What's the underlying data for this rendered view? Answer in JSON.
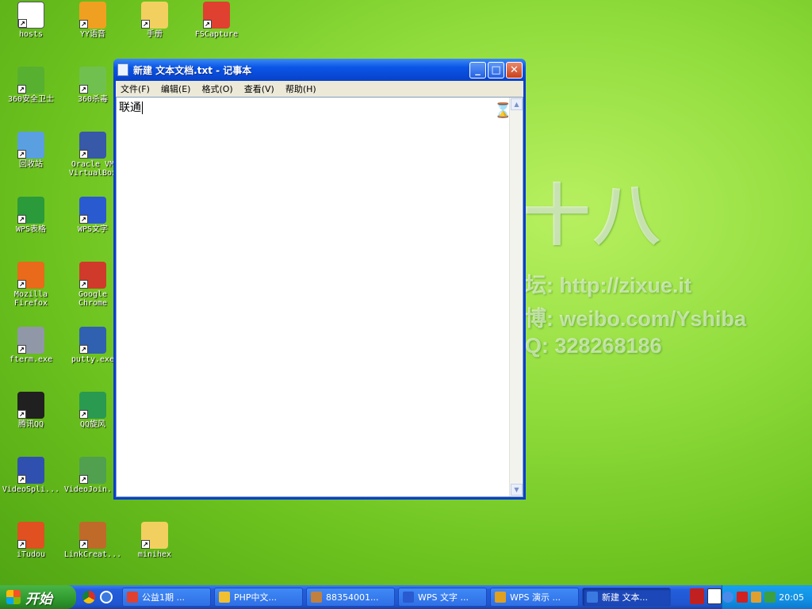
{
  "wallpaper": {
    "logo": "十八",
    "line1": "坛: http://zixue.it",
    "line2": "博: weibo.com/Yshiba",
    "line3": "Q: 328268186"
  },
  "desktop_icons": [
    {
      "label": "hosts",
      "icon": "text-file-icon",
      "color": "#ffffff"
    },
    {
      "label": "YY语音",
      "icon": "yy-voice-icon",
      "color": "#f0a020"
    },
    {
      "label": "手册",
      "icon": "folder-icon",
      "color": "#f2d060"
    },
    {
      "label": "FSCapture",
      "icon": "fscapture-icon",
      "color": "#e04030"
    },
    {
      "label": "360安全卫士",
      "icon": "360-security-icon",
      "color": "#58b030"
    },
    {
      "label": "360杀毒",
      "icon": "360-antivirus-icon",
      "color": "#70c050"
    },
    {
      "label": "回收站",
      "icon": "recycle-bin-icon",
      "color": "#5aa0e0"
    },
    {
      "label": "Oracle VM\nVirtualBox",
      "icon": "virtualbox-icon",
      "color": "#3858a8"
    },
    {
      "label": "WPS表格",
      "icon": "wps-spreadsheet-icon",
      "color": "#2a9a3a"
    },
    {
      "label": "WPS文字",
      "icon": "wps-writer-icon",
      "color": "#2a5ad0"
    },
    {
      "label": "Mozilla\nFirefox",
      "icon": "firefox-icon",
      "color": "#e86a1a"
    },
    {
      "label": "Google\nChrome",
      "icon": "chrome-icon",
      "color": "#d03a2a"
    },
    {
      "label": "fterm.exe",
      "icon": "fterm-icon",
      "color": "#9098a8"
    },
    {
      "label": "putty.exe",
      "icon": "putty-icon",
      "color": "#3060b0"
    },
    {
      "label": "腾讯QQ",
      "icon": "qq-penguin-icon",
      "color": "#202020"
    },
    {
      "label": "QQ旋风",
      "icon": "qq-whirlwind-icon",
      "color": "#2a9a50"
    },
    {
      "label": "VideoSpli...",
      "icon": "videosplitter-icon",
      "color": "#3050b0"
    },
    {
      "label": "VideoJoin...",
      "icon": "videojoiner-icon",
      "color": "#50a050"
    },
    {
      "label": "iTudou",
      "icon": "itudou-icon",
      "color": "#e05020"
    },
    {
      "label": "LinkCreat...",
      "icon": "linkcreator-icon",
      "color": "#c06a2a"
    },
    {
      "label": "minihex",
      "icon": "folder-icon",
      "color": "#f2d060"
    }
  ],
  "notepad": {
    "title": "新建 文本文档.txt - 记事本",
    "menu": [
      "文件(F)",
      "编辑(E)",
      "格式(O)",
      "查看(V)",
      "帮助(H)"
    ],
    "content": "联通",
    "buttons": {
      "minimize": "_",
      "maximize": "□",
      "close": "✕"
    }
  },
  "taskbar": {
    "start_label": "开始",
    "tasks": [
      "公益1期 ...",
      "PHP中文...",
      "88354001...",
      "WPS 文字 ...",
      "WPS 演示 ...",
      "新建 文本..."
    ],
    "clock": "20:05"
  }
}
